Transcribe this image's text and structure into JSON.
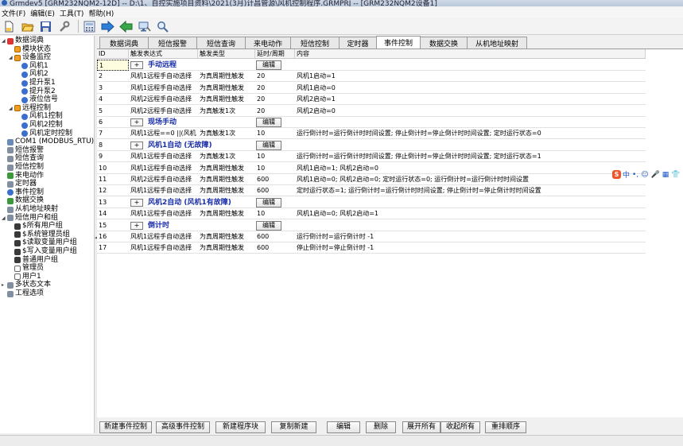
{
  "window": {
    "title": "Grmdev5 [GRM232NQM2-12D] -- D:\\1、自控实施项目资料\\2021(3月)计昌管源\\风机控制程序.GRMPRJ -- [GRM232NQM2设备1]"
  },
  "menu": [
    "文件(F)",
    "编辑(E)",
    "工具(T)",
    "帮助(H)"
  ],
  "toolbar": {
    "icons": [
      "new-file-icon",
      "open-folder-icon",
      "save-icon",
      "wrench-icon",
      "calculator-icon",
      "download-arrow-icon",
      "upload-arrow-icon",
      "monitor-icon",
      "search-icon"
    ]
  },
  "tree": {
    "nodes": [
      {
        "label": "数据词典",
        "depth": 0,
        "icon": "red",
        "exp": "-"
      },
      {
        "label": "模块状态",
        "depth": 1,
        "icon": "orange",
        "exp": ""
      },
      {
        "label": "设备监控",
        "depth": 1,
        "icon": "orange",
        "exp": "-"
      },
      {
        "label": "风机1",
        "depth": 2,
        "icon": "blue",
        "exp": ""
      },
      {
        "label": "风机2",
        "depth": 2,
        "icon": "blue",
        "exp": ""
      },
      {
        "label": "提升泵1",
        "depth": 2,
        "icon": "blue",
        "exp": ""
      },
      {
        "label": "提升泵2",
        "depth": 2,
        "icon": "blue",
        "exp": ""
      },
      {
        "label": "液位信号",
        "depth": 2,
        "icon": "blue",
        "exp": ""
      },
      {
        "label": "远程控制",
        "depth": 1,
        "icon": "orange",
        "exp": "-"
      },
      {
        "label": "风机1控制",
        "depth": 2,
        "icon": "blue",
        "exp": ""
      },
      {
        "label": "风机2控制",
        "depth": 2,
        "icon": "blue",
        "exp": ""
      },
      {
        "label": "风机定时控制",
        "depth": 2,
        "icon": "blue",
        "exp": ""
      },
      {
        "label": "COM1 (MODBUS_RTU)",
        "depth": 0,
        "icon": "pc",
        "exp": ""
      },
      {
        "label": "短信报警",
        "depth": 0,
        "icon": "gray",
        "exp": ""
      },
      {
        "label": "短信查询",
        "depth": 0,
        "icon": "gray",
        "exp": ""
      },
      {
        "label": "短信控制",
        "depth": 0,
        "icon": "gray",
        "exp": ""
      },
      {
        "label": "来电动作",
        "depth": 0,
        "icon": "green",
        "exp": ""
      },
      {
        "label": "定时器",
        "depth": 0,
        "icon": "gray",
        "exp": ""
      },
      {
        "label": "事件控制",
        "depth": 0,
        "icon": "blue",
        "exp": ""
      },
      {
        "label": "数据交换",
        "depth": 0,
        "icon": "green",
        "exp": ""
      },
      {
        "label": "从机地址映射",
        "depth": 0,
        "icon": "gray",
        "exp": ""
      },
      {
        "label": "短信用户和组",
        "depth": 0,
        "icon": "gray",
        "exp": "-"
      },
      {
        "label": "$所有用户组",
        "depth": 1,
        "icon": "group",
        "exp": ""
      },
      {
        "label": "$系统管理员组",
        "depth": 1,
        "icon": "group",
        "exp": ""
      },
      {
        "label": "$读取变量用户组",
        "depth": 1,
        "icon": "group",
        "exp": ""
      },
      {
        "label": "$写入变量用户组",
        "depth": 1,
        "icon": "group",
        "exp": ""
      },
      {
        "label": "普通用户组",
        "depth": 1,
        "icon": "group",
        "exp": ""
      },
      {
        "label": "管理员",
        "depth": 1,
        "icon": "user",
        "exp": ""
      },
      {
        "label": "用户1",
        "depth": 1,
        "icon": "user",
        "exp": ""
      },
      {
        "label": "多状态文本",
        "depth": 0,
        "icon": "gray",
        "exp": "+"
      },
      {
        "label": "工程选项",
        "depth": 0,
        "icon": "gray",
        "exp": ""
      }
    ]
  },
  "tabs": [
    {
      "label": "数据词典",
      "active": false
    },
    {
      "label": "短信报警",
      "active": false
    },
    {
      "label": "短信查询",
      "active": false
    },
    {
      "label": "来电动作",
      "active": false
    },
    {
      "label": "短信控制",
      "active": false
    },
    {
      "label": "定时器",
      "active": false
    },
    {
      "label": "事件控制",
      "active": true
    },
    {
      "label": "数据交换",
      "active": false
    },
    {
      "label": "从机地址映射",
      "active": false
    }
  ],
  "grid": {
    "columns": [
      "ID",
      "触发表达式",
      "触发类型",
      "延时/周期",
      "内容"
    ],
    "edit_label": "编辑",
    "plus_label": "+",
    "rows": [
      {
        "id": "1",
        "group": true,
        "title": "手动远程",
        "selected": true
      },
      {
        "id": "2",
        "expr": "风机1远程手自动选择",
        "type": "为真周期性触发",
        "delay": "20",
        "content": "风机1启动=1"
      },
      {
        "id": "3",
        "expr": "风机1远程手自动选择",
        "type": "为真周期性触发",
        "delay": "20",
        "content": "风机1启动=0"
      },
      {
        "id": "4",
        "expr": "风机2远程手自动选择",
        "type": "为真周期性触发",
        "delay": "20",
        "content": "风机2启动=1"
      },
      {
        "id": "5",
        "expr": "风机2远程手自动选择",
        "type": "为真触发1次",
        "delay": "20",
        "content": "风机2启动=0"
      },
      {
        "id": "6",
        "group": true,
        "title": "现场手动"
      },
      {
        "id": "7",
        "expr": "风机1远程==0 ||(风机",
        "type": "为真触发1次",
        "delay": "10",
        "content": "运行倒计时=运行倒计时时间设置; 停止倒计时=停止倒计时时间设置; 定时运行状态=0"
      },
      {
        "id": "8",
        "group": true,
        "title": "风机1自动 (无故障)"
      },
      {
        "id": "9",
        "expr": "风机1远程手自动选择",
        "type": "为真触发1次",
        "delay": "10",
        "content": "运行倒计时=运行倒计时时间设置; 停止倒计时=停止倒计时时间设置; 定时运行状态=1"
      },
      {
        "id": "10",
        "expr": "风机1远程手自动选择",
        "type": "为真周期性触发",
        "delay": "10",
        "content": "风机1启动=1; 风机2启动=0"
      },
      {
        "id": "11",
        "expr": "风机2远程手自动选择",
        "type": "为真周期性触发",
        "delay": "600",
        "content": "风机1启动=0; 风机2启动=0; 定时运行状态=0; 运行倒计时=运行倒计时时间设置"
      },
      {
        "id": "12",
        "expr": "风机1远程手自动选择",
        "type": "为真周期性触发",
        "delay": "600",
        "content": "定时运行状态=1; 运行倒计时=运行倒计时时间设置; 停止倒计时=停止倒计时时间设置"
      },
      {
        "id": "13",
        "group": true,
        "title": "风机2自动 (风机1有故障)"
      },
      {
        "id": "14",
        "expr": "风机1远程手自动选择",
        "type": "为真周期性触发",
        "delay": "10",
        "content": "风机1启动=0; 风机2启动=1"
      },
      {
        "id": "15",
        "group": true,
        "title": "倒计时"
      },
      {
        "id": "16",
        "expr": "风机1远程手自动选择",
        "type": "为真周期性触发",
        "delay": "600",
        "content": "运行倒计时=运行倒计时 -1"
      },
      {
        "id": "17",
        "expr": "风机1远程手自动选择",
        "type": "为真周期性触发",
        "delay": "600",
        "content": "停止倒计时=停止倒计时 -1"
      }
    ]
  },
  "buttons": [
    "新建事件控制",
    "高级事件控制",
    "新建程序块",
    "复制新建",
    "编辑",
    "删除",
    "展开所有",
    "收起所有",
    "重排顺序"
  ],
  "ime": {
    "logo": "S",
    "items": [
      "中",
      "•,",
      "☺",
      "🎤",
      "▦",
      "👕"
    ]
  }
}
